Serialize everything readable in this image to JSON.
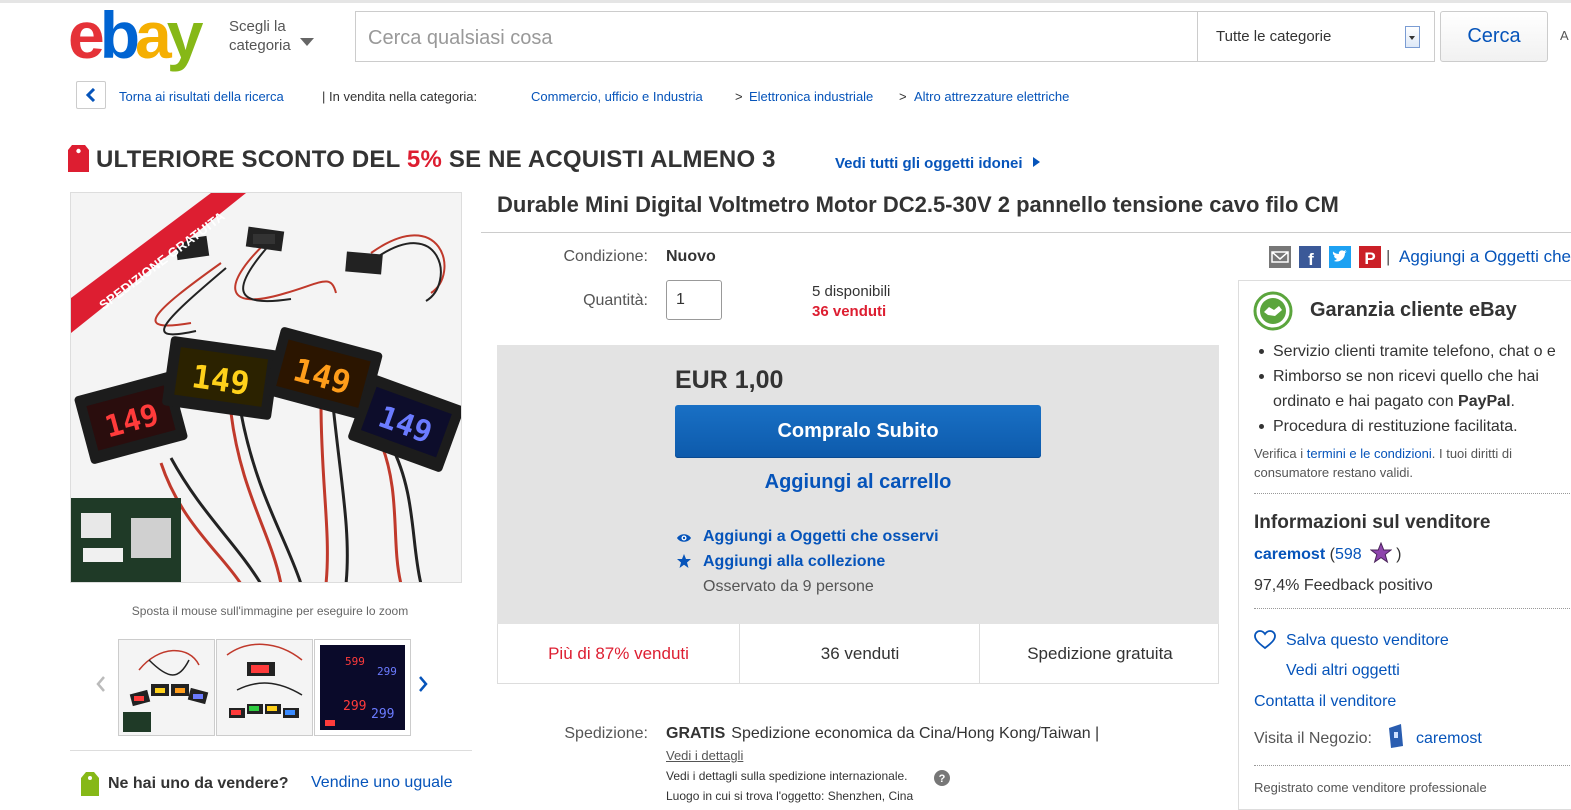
{
  "header": {
    "logo_text": "ebay",
    "category_picker": {
      "line1": "Scegli la",
      "line2": "categoria"
    },
    "search_placeholder": "Cerca qualsiasi cosa",
    "category_select": "Tutte le categorie",
    "search_button": "Cerca",
    "right_edge_text": "A"
  },
  "breadcrumb": {
    "back": "Torna ai risultati della ricerca",
    "sep": "| In vendita nella categoria:",
    "items": [
      "Commercio, ufficio e Industria",
      "Elettronica industriale",
      "Altro attrezzature elettriche"
    ],
    "arrow": ">"
  },
  "promo": {
    "prefix": "ULTERIORE SCONTO DEL ",
    "percent": "5%",
    "suffix": " SE NE ACQUISTI ALMENO 3",
    "link": "Vedi tutti gli oggetti idonei"
  },
  "image_panel": {
    "badge": "SPEDIZIONE GRATUITA",
    "display_values": [
      "149",
      "149",
      "149",
      "149"
    ],
    "zoom_hint": "Sposta il mouse sull'immagine per eseguire lo zoom",
    "thumb_values": [
      "299",
      "299",
      "299",
      "599"
    ]
  },
  "sell_prompt": {
    "question": "Ne hai uno da vendere?",
    "link": "Vendine uno uguale"
  },
  "item": {
    "title": "Durable Mini Digital Voltmetro Motor DC2.5-30V 2 pannello tensione cavo filo CM",
    "condition_label": "Condizione:",
    "condition_value": "Nuovo",
    "quantity_label": "Quantità:",
    "quantity_value": "1",
    "available": "5 disponibili",
    "sold": "36 venduti"
  },
  "buybox": {
    "price": "EUR 1,00",
    "buy_now": "Compralo Subito",
    "add_cart": "Aggiungi al carrello",
    "watch": "Aggiungi a Oggetti che osservi",
    "collection": "Aggiungi alla collezione",
    "watched_by": "Osservato da 9 persone"
  },
  "stats": [
    "Più di 87% venduti",
    "36 venduti",
    "Spedizione gratuita"
  ],
  "shipping": {
    "label": "Spedizione:",
    "free": "GRATIS",
    "method": "Spedizione economica da Cina/Hong Kong/Taiwan |",
    "details": "Vedi i dettagli",
    "intl": "Vedi i dettagli sulla spedizione internazionale.",
    "location": "Luogo in cui si trova l'oggetto:  Shenzhen, Cina"
  },
  "right": {
    "share_link": "Aggiungi a Oggetti che",
    "guarantee_title": "Garanzia cliente eBay",
    "bullets": [
      "Servizio clienti tramite telefono, chat o e",
      "Rimborso se non ricevi quello che hai",
      "ordinato e hai pagato con ",
      "Procedura di restituzione facilitata."
    ],
    "paypal": "PayPal",
    "verify_prefix": "Verifica i ",
    "verify_link": "termini e le condizioni",
    "verify_suffix": ". I tuoi diritti di consumatore restano validi.",
    "seller_title": "Informazioni sul venditore",
    "seller_name": "caremost",
    "seller_score": "598",
    "feedback": "97,4% Feedback positivo",
    "save_seller": "Salva questo venditore",
    "other_items": "Vedi altri oggetti",
    "contact": "Contatta il venditore",
    "store_label": "Visita il Negozio:",
    "store_name": "caremost",
    "registered": "Registrato come venditore professionale"
  },
  "colors": {
    "accent_blue": "#0654ba",
    "red": "#dd1e31",
    "buy_button": "#1565c0"
  }
}
